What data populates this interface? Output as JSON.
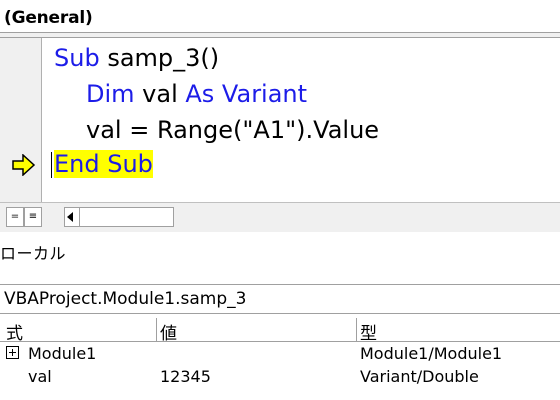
{
  "object_dropdown": {
    "value": "(General)"
  },
  "code": {
    "line1": {
      "kw": "Sub",
      "rest": " samp_3()"
    },
    "line2": {
      "kw1": "Dim",
      "mid": " val ",
      "kw2": "As Variant"
    },
    "line3": {
      "text": "val = Range(\"A1\").Value"
    },
    "line4": {
      "text": "End Sub"
    }
  },
  "view_bar": {
    "procedure_view_icon": "=",
    "full_module_view_icon": "≡"
  },
  "locals": {
    "title": "ローカル",
    "context": "VBAProject.Module1.samp_3",
    "headers": {
      "expr": "式",
      "value": "値",
      "type": "型"
    },
    "rows": [
      {
        "expr": "Module1",
        "value": "",
        "type": "Module1/Module1"
      },
      {
        "expr": "val",
        "value": "12345",
        "type": "Variant/Double"
      }
    ]
  },
  "colors": {
    "keyword": "#1c1ce8",
    "highlight": "#ffff00",
    "arrow": "#ffff00"
  }
}
